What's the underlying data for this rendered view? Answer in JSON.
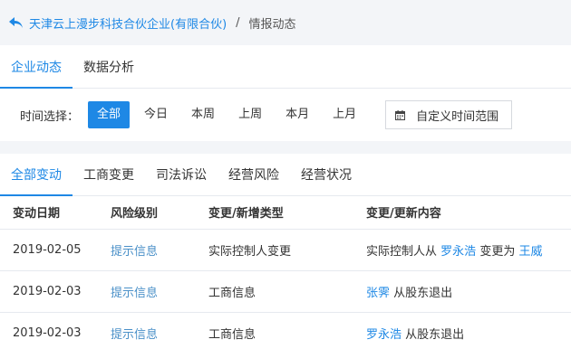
{
  "breadcrumb": {
    "back_icon": "back-arrow-icon",
    "company": "天津云上漫步科技合伙企业(有限合伙)",
    "separator": "/",
    "current": "情报动态"
  },
  "top_tabs": [
    "企业动态",
    "数据分析"
  ],
  "filter": {
    "label": "时间选择：",
    "options": [
      "全部",
      "今日",
      "本周",
      "上周",
      "本月",
      "上月"
    ],
    "selected": "全部",
    "custom_range_icon": "calendar-icon",
    "custom_range_label": "自定义时间范围"
  },
  "change_tabs": [
    "全部变动",
    "工商变更",
    "司法诉讼",
    "经营风险",
    "经营状况"
  ],
  "table": {
    "headers": [
      "变动日期",
      "风险级别",
      "变更/新增类型",
      "变更/更新内容"
    ],
    "rows": [
      {
        "date": "2019-02-05",
        "risk": "提示信息",
        "type": "实际控制人变更",
        "c1": "实际控制人从",
        "l1": "罗永浩",
        "c2": "变更为",
        "l2": "王威"
      },
      {
        "date": "2019-02-03",
        "risk": "提示信息",
        "type": "工商信息",
        "l1": "张霁",
        "c2": "从股东退出"
      },
      {
        "date": "2019-02-03",
        "risk": "提示信息",
        "type": "工商信息",
        "l1": "罗永浩",
        "c2": "从股东退出"
      }
    ]
  },
  "colors": {
    "accent": "#1e88e5",
    "background": "#f3f5f8"
  }
}
